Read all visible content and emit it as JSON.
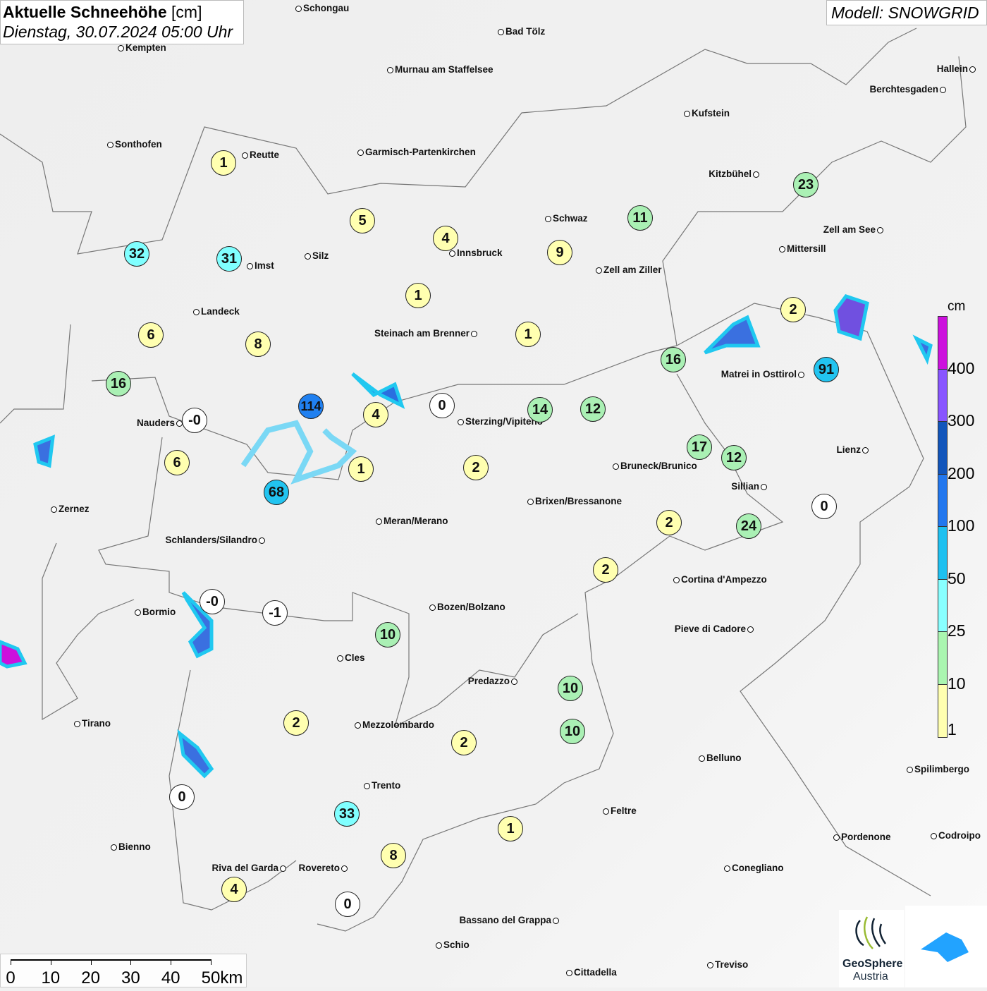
{
  "title": {
    "main": "Aktuelle Schneehöhe",
    "unit": "[cm]",
    "datetime": "Dienstag, 30.07.2024 05:00 Uhr"
  },
  "model": "Modell: SNOWGRID",
  "legend": {
    "unit": "cm",
    "levels": [
      "400",
      "300",
      "200",
      "100",
      "50",
      "25",
      "10",
      "1"
    ],
    "colors": [
      "#cc11dd",
      "#8855ff",
      "#1155bb",
      "#2277ee",
      "#1ec0f0",
      "#88ffff",
      "#aaf5b0",
      "#ffffb0"
    ]
  },
  "marker_colors": {
    "below_1": "#ffffff",
    "1_10": "#ffffb0",
    "10_25": "#aaf0b4",
    "25_50": "#80ffff",
    "50_100": "#22c4f0",
    "100_200": "#2080f0"
  },
  "snow_depth_markers": [
    "1",
    "5",
    "4",
    "9",
    "11",
    "23",
    "32",
    "31",
    "1",
    "1",
    "2",
    "6",
    "8",
    "16",
    "91",
    "16",
    "114",
    "4",
    "0",
    "14",
    "12",
    "-0",
    "6",
    "17",
    "12",
    "68",
    "1",
    "2",
    "0",
    "2",
    "24",
    "2",
    "-0",
    "-1",
    "10",
    "10",
    "2",
    "10",
    "2",
    "0",
    "33",
    "1",
    "8",
    "4",
    "0"
  ],
  "cities": [
    "Schongau",
    "Bad Tölz",
    "Kempten",
    "Murnau am Staffelsee",
    "Hallein",
    "Berchtesgaden",
    "Kufstein",
    "Sonthofen",
    "Reutte",
    "Garmisch-Partenkirchen",
    "Kitzbühel",
    "Schwaz",
    "Zell am See",
    "Mittersill",
    "Silz",
    "Innsbruck",
    "Imst",
    "Zell am Ziller",
    "Landeck",
    "Steinach am Brenner",
    "Matrei in Osttirol",
    "Nauders",
    "Sterzing/Vipiteno",
    "Lienz",
    "Bruneck/Brunico",
    "Sillian",
    "Zernez",
    "Brixen/Bressanone",
    "Meran/Merano",
    "Schlanders/Silandro",
    "Cortina d'Ampezzo",
    "Bozen/Bolzano",
    "Bormio",
    "Pieve di Cadore",
    "Cles",
    "Predazzo",
    "Tirano",
    "Mezzolombardo",
    "Belluno",
    "Spilimbergo",
    "Trento",
    "Feltre",
    "Pordenone",
    "Codroipo",
    "Bienno",
    "Riva del Garda",
    "Rovereto",
    "Conegliano",
    "Bassano del Grappa",
    "Schio",
    "Treviso",
    "Cittadella"
  ],
  "scale_bar": {
    "labels": [
      "0",
      "10",
      "20",
      "30",
      "40",
      "50km"
    ]
  },
  "logos": {
    "geosphere_line1": "GeoSphere",
    "geosphere_line2": "Austria"
  }
}
